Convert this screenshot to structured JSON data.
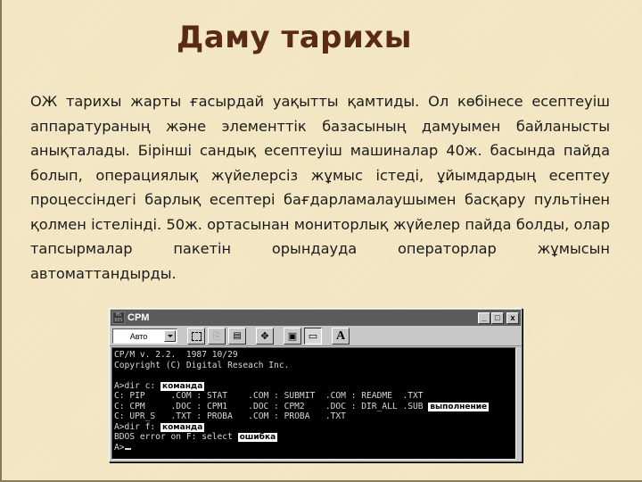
{
  "slide": {
    "title": "Даму тарихы",
    "paragraph": "ОЖ тарихы жарты ғасырдай уақытты қамтиды. Ол көбінесе есептеуіш аппаратураның және элементтік базасының дамуымен байланысты анықталады. Бірінші сандық есептеуіш машиналар 40ж. басында пайда болып, операциялық жүйелерсіз жұмыс істеді, ұйымдардың есептеу процессіндегі барлық есептері бағдарламалаушымен басқару пультінен қолмен істелінді. 50ж. ортасынан мониторлық жүйелер пайда болды, олар тапсырмалар пакетін орындауда операторлар жұмысын автоматтандырды."
  },
  "window": {
    "icon_text": "MS DOS",
    "title": "CPM",
    "controls": {
      "minimize": "_",
      "maximize": "□",
      "close": "x"
    },
    "toolbar": {
      "font_select_value": "Авто",
      "tools": [
        {
          "name": "mark-icon",
          "state": "normal"
        },
        {
          "name": "copy-icon",
          "state": "disabled",
          "glyph": "⎘"
        },
        {
          "name": "paste-icon",
          "state": "normal",
          "glyph": "📋"
        },
        {
          "name": "fullscreen-icon",
          "state": "normal",
          "glyph": "✥"
        },
        {
          "name": "properties-icon",
          "state": "normal",
          "glyph": "▣"
        },
        {
          "name": "background-icon",
          "state": "pressed",
          "glyph": "▭"
        },
        {
          "name": "font-icon",
          "state": "normal",
          "glyph": "A"
        }
      ]
    },
    "console": {
      "lines": [
        {
          "text": "CP/M v. 2.2.  1987 10/29"
        },
        {
          "text": "Copyright (C) Digital Reseach Inc."
        },
        {
          "text": ""
        },
        {
          "text": "A>dir c: ",
          "tag": "команда"
        },
        {
          "text": "C: PIP     .COM : STAT    .COM : SUBMIT  .COM : README  .TXT"
        },
        {
          "text": "C: CPM     .DOC : CPM1    .DOC : CPM2    .DOC : DIR_ALL .SUB ",
          "tag": "выполнение"
        },
        {
          "text": "C: UPR_S   .TXT : PROBA   .COM : PROBA   .TXT"
        },
        {
          "text": "A>dir f: ",
          "tag": "команда"
        },
        {
          "text": "BDOS error on F: select ",
          "tag": "ошибка"
        },
        {
          "text": "A>",
          "cursor": true
        }
      ]
    }
  }
}
